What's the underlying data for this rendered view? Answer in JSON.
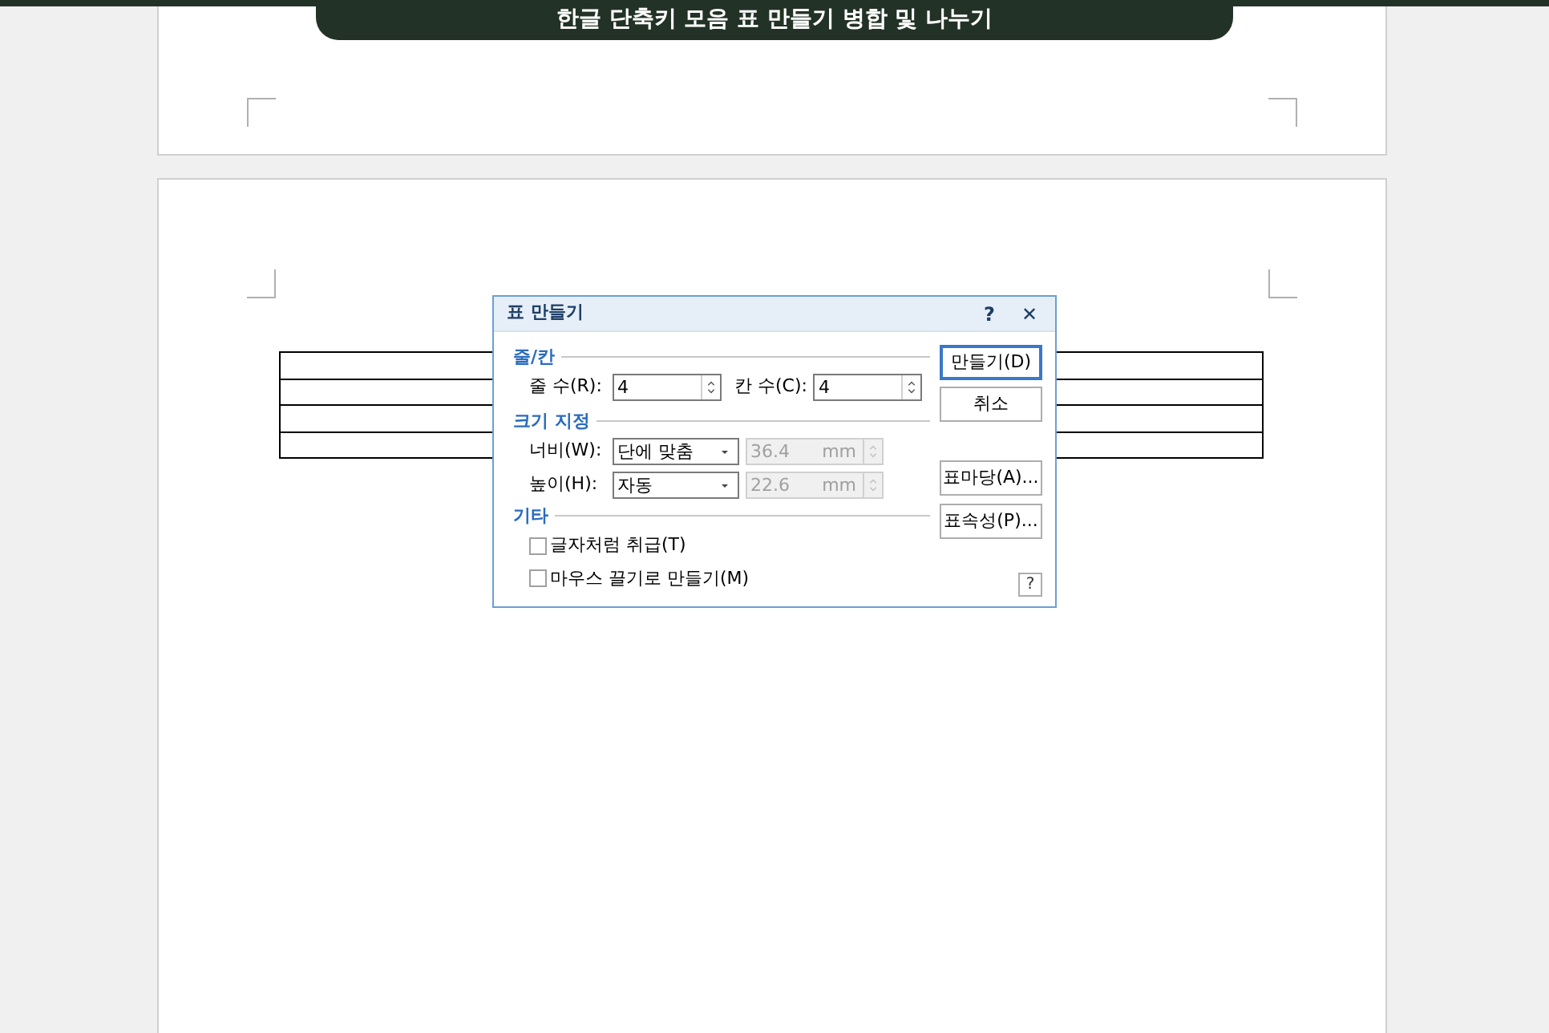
{
  "banner": {
    "title": "한글 단축키 모음 표 만들기 병합 및 나누기"
  },
  "dialog": {
    "title": "표 만들기",
    "help_button": "?",
    "close_button": "✕",
    "groups": [
      {
        "title": "줄/칸"
      },
      {
        "title": "크기 지정"
      },
      {
        "title": "기타"
      }
    ],
    "rows_label": "줄 수(R):",
    "rows_value": "4",
    "cols_label": "칸 수(C):",
    "cols_value": "4",
    "width": {
      "label": "너비(W):",
      "select": "단에 맞춤",
      "value": "36.4",
      "unit": "mm",
      "disabled": true
    },
    "height": {
      "label": "높이(H):",
      "select": "자동",
      "value": "22.6",
      "unit": "mm",
      "disabled": true
    },
    "checkboxes": [
      {
        "label": "글자처럼 취급(T)",
        "checked": false
      },
      {
        "label": "마우스 끌기로 만들기(M)",
        "checked": false
      }
    ],
    "buttons": [
      {
        "label": "만들기(D)",
        "selected": true
      },
      {
        "label": "취소",
        "selected": false
      },
      {
        "label": "표마당(A)...",
        "selected": false
      },
      {
        "label": "표속성(P)...",
        "selected": false
      }
    ],
    "footer_help": "?"
  }
}
